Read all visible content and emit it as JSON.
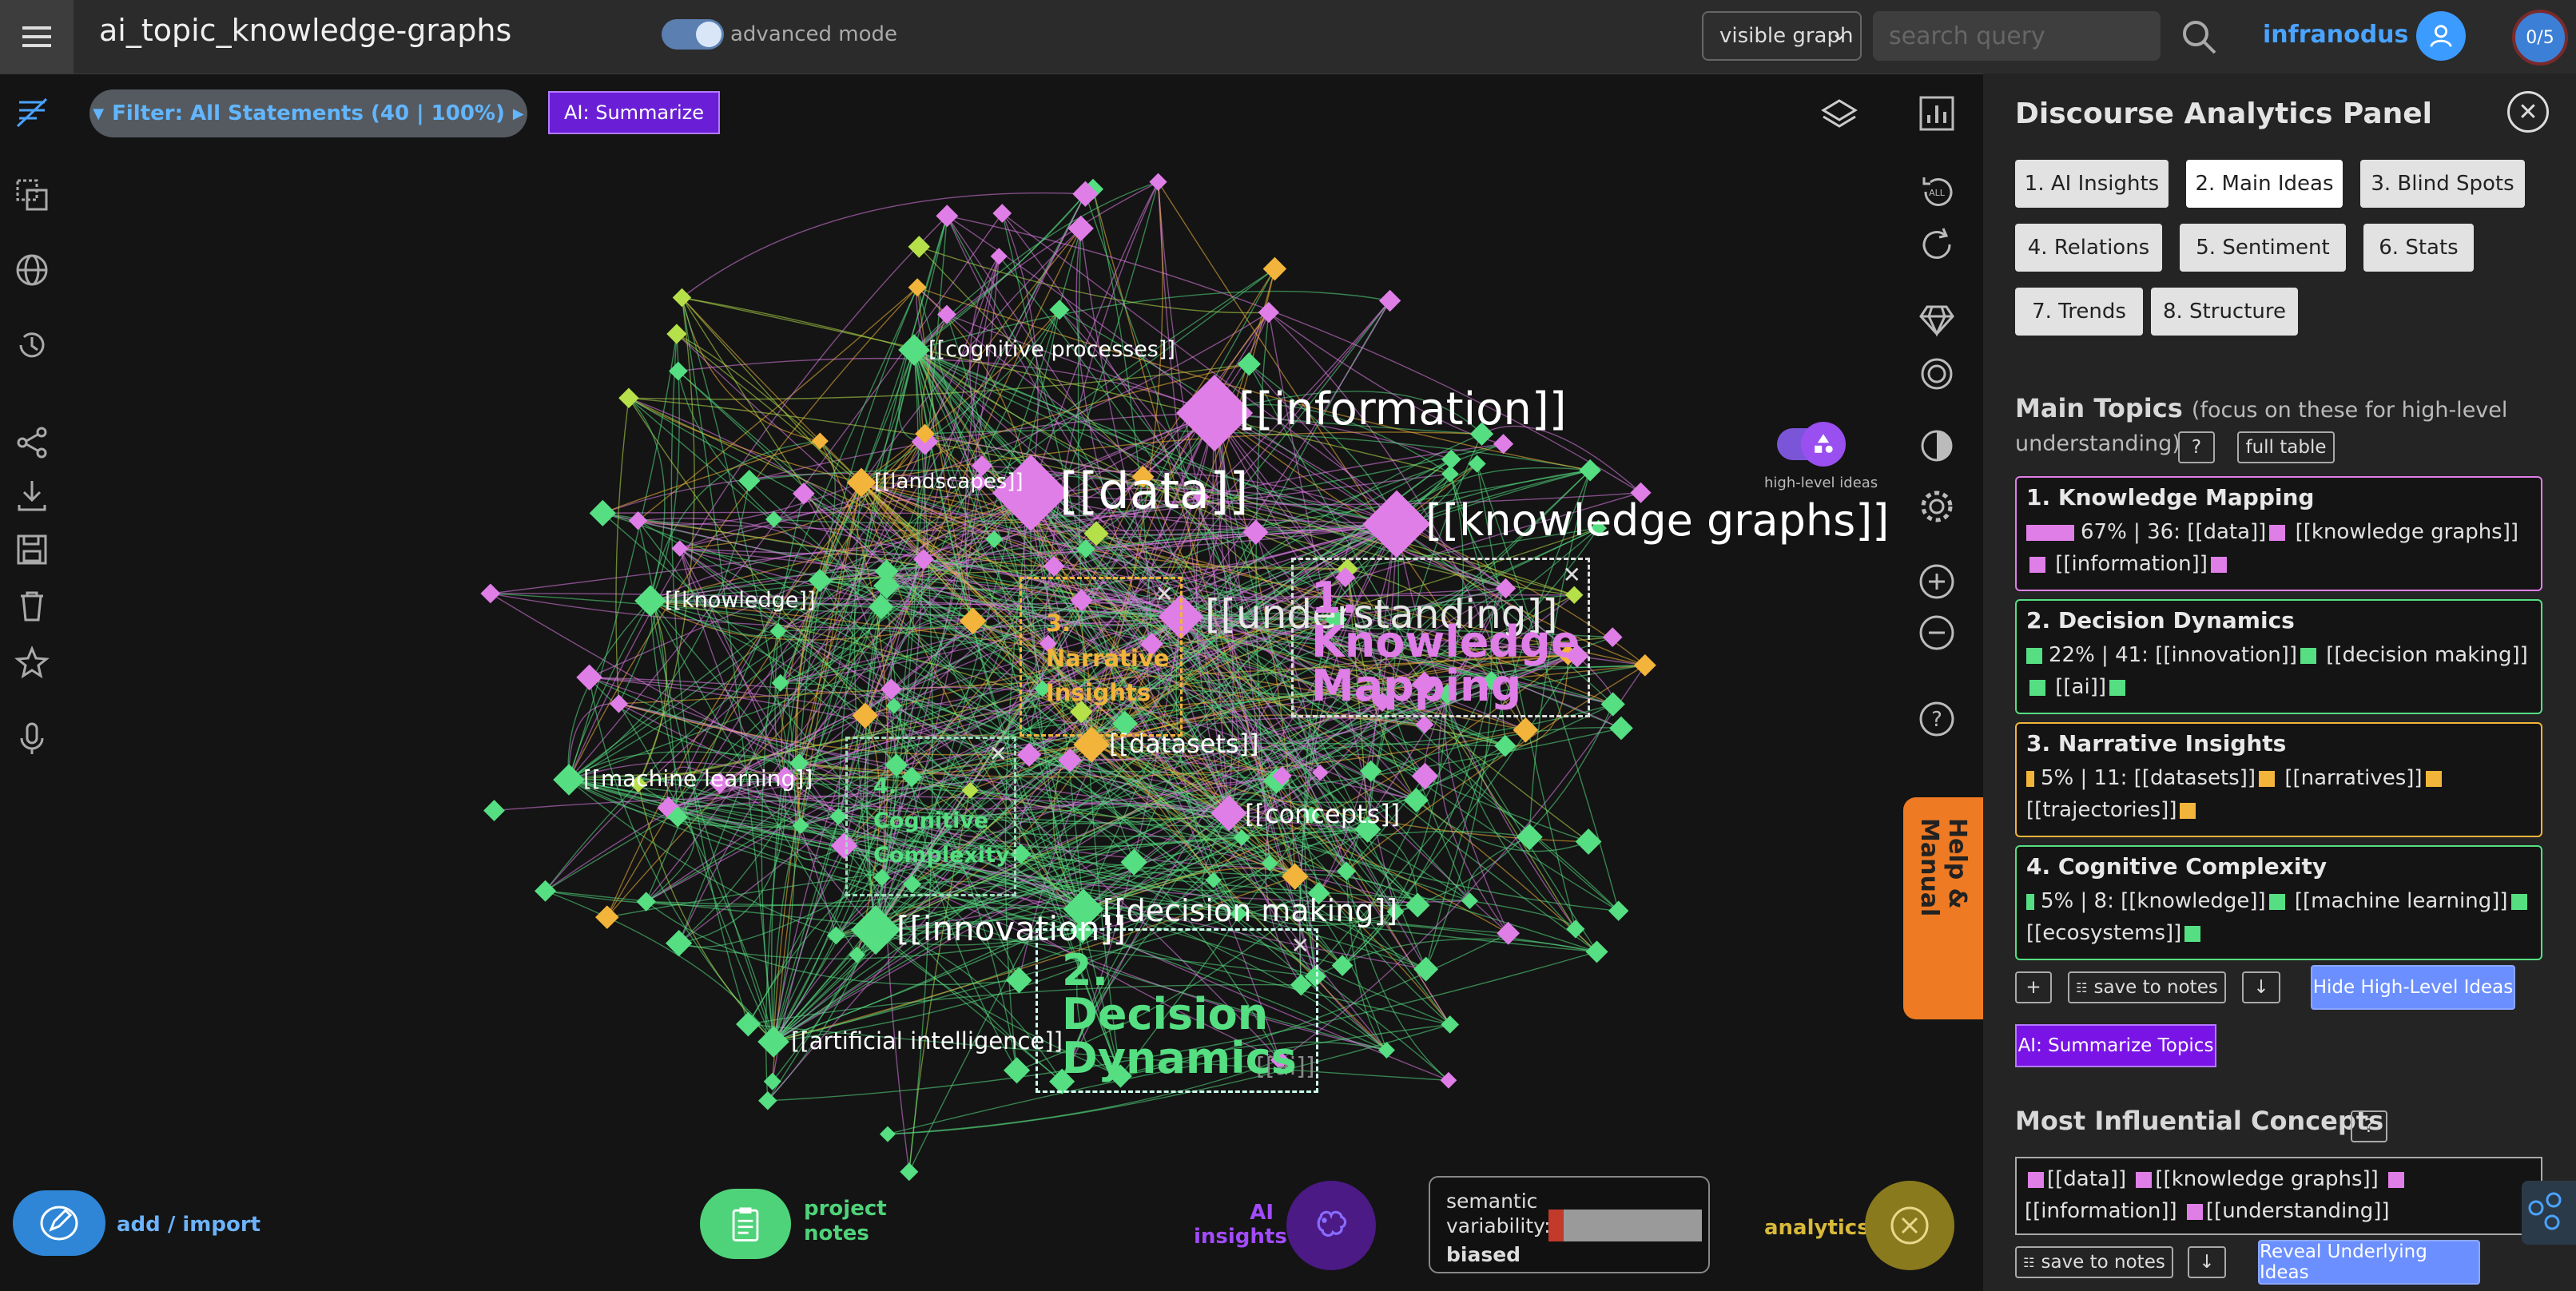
{
  "header": {
    "title": "ai_topic_knowledge-graphs",
    "advanced_mode_label": "advanced mode",
    "graph_select_value": "visible graph",
    "search_placeholder": "search query",
    "brand": "infranodus",
    "counter": "0/5"
  },
  "toolbar": {
    "filter_label": "Filter: All Statements (40 | 100%)",
    "ai_summarize_label": "AI: Summarize",
    "high_level_ideas_label": "high-level ideas",
    "help_manual_label": "Help & Manual"
  },
  "colors": {
    "pink": "#e07ee8",
    "green": "#55df82",
    "orange": "#f2b43a",
    "lime": "#b6e04a",
    "accent_blue": "#4aa3ff"
  },
  "graph": {
    "node_labels": [
      {
        "text": "[[information]]",
        "cluster": "pink"
      },
      {
        "text": "[[data]]",
        "cluster": "pink"
      },
      {
        "text": "[[knowledge graphs]]",
        "cluster": "pink"
      },
      {
        "text": "[[understanding]]",
        "cluster": "pink"
      },
      {
        "text": "[[concepts]]",
        "cluster": "pink"
      },
      {
        "text": "[[cognitive processes]]",
        "cluster": "green"
      },
      {
        "text": "[[landscapes]]",
        "cluster": "orange"
      },
      {
        "text": "[[knowledge]]",
        "cluster": "green"
      },
      {
        "text": "[[machine learning]]",
        "cluster": "green"
      },
      {
        "text": "[[datasets]]",
        "cluster": "orange"
      },
      {
        "text": "[[innovation]]",
        "cluster": "green"
      },
      {
        "text": "[[decision making]]",
        "cluster": "green"
      },
      {
        "text": "[[artificial intelligence]]",
        "cluster": "green"
      },
      {
        "text": "[[ai]]",
        "cluster": "green"
      }
    ],
    "clusters": [
      {
        "title": "1. Knowledge Mapping"
      },
      {
        "title": "2. Decision Dynamics"
      },
      {
        "title": "3. Narrative Insights"
      },
      {
        "title": "4. Cognitive Complexity"
      }
    ]
  },
  "bottom": {
    "add_import_label": "add / import",
    "project_notes_label": "project notes",
    "ai_insights_label": "AI insights",
    "variability_label": "semantic variability:",
    "variability_value": "biased",
    "variability_level": 0.1,
    "analytics_label": "analytics"
  },
  "panel": {
    "title": "Discourse Analytics Panel",
    "tabs": [
      {
        "label": "1. AI Insights"
      },
      {
        "label": "2. Main Ideas",
        "active": true
      },
      {
        "label": "3. Blind Spots"
      },
      {
        "label": "4. Relations"
      },
      {
        "label": "5. Sentiment"
      },
      {
        "label": "6. Stats"
      },
      {
        "label": "7. Trends"
      },
      {
        "label": "8. Structure"
      }
    ],
    "main_topics": {
      "heading": "Main Topics",
      "subheading_part1": "(focus on these for high-level",
      "subheading_part2": "understanding)",
      "help_label": "?",
      "full_table_label": "full table"
    },
    "topics": [
      {
        "name": "1. Knowledge Mapping",
        "stats": "67% | 36:",
        "concepts": [
          "[[data]]",
          "[[knowledge graphs]]",
          "[[information]]"
        ],
        "color": "#e07ee8",
        "share": 0.67
      },
      {
        "name": "2. Decision Dynamics",
        "stats": "22% | 41:",
        "concepts": [
          "[[innovation]]",
          "[[decision making]]",
          "[[ai]]"
        ],
        "color": "#55df82",
        "share": 0.22
      },
      {
        "name": "3. Narrative Insights",
        "stats": "5% | 11:",
        "concepts": [
          "[[datasets]]",
          "[[narratives]]",
          "[[trajectories]]"
        ],
        "color": "#f2b43a",
        "share": 0.05
      },
      {
        "name": "4. Cognitive Complexity",
        "stats": "5% | 8:",
        "concepts": [
          "[[knowledge]]",
          "[[machine learning]]",
          "[[ecosystems]]"
        ],
        "color": "#55df82",
        "share": 0.05
      }
    ],
    "topic_actions": {
      "plus_label": "+",
      "save_label": "save to notes",
      "download_label": "↓",
      "hide_label": "Hide High-Level Ideas",
      "ai_summarize_topics_label": "AI: Summarize Topics"
    },
    "influential": {
      "heading": "Most Influential Concepts",
      "help_label": "?",
      "concepts": [
        "[[data]]",
        "[[knowledge graphs]]",
        "[[information]]",
        "[[understanding]]"
      ],
      "save_label": "save to notes",
      "download_label": "↓",
      "reveal_label": "Reveal Underlying Ideas"
    }
  }
}
